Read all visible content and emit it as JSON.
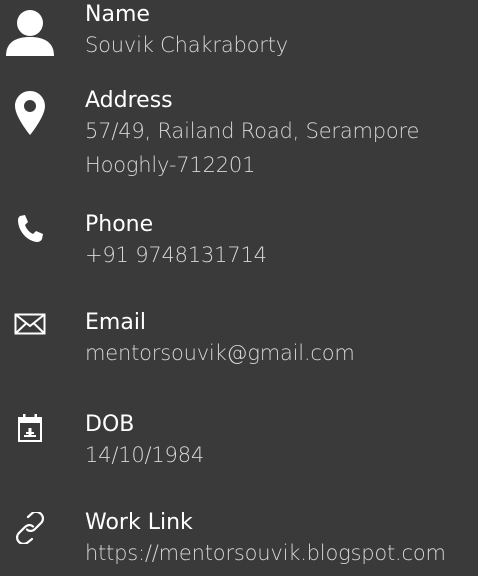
{
  "profile": {
    "name": {
      "label": "Name",
      "value": "Souvik Chakraborty",
      "icon": "user-icon"
    },
    "address": {
      "label": "Address",
      "line1": "57/49, Railand Road, Serampore",
      "line2": "Hooghly-712201",
      "icon": "location-pin-icon"
    },
    "phone": {
      "label": "Phone",
      "value": "+91 9748131714",
      "icon": "phone-icon"
    },
    "email": {
      "label": "Email",
      "value": "mentorsouvik@gmail.com",
      "icon": "envelope-icon"
    },
    "dob": {
      "label": "DOB",
      "value": "14/10/1984",
      "icon": "calendar-icon"
    },
    "work_link": {
      "label": "Work Link",
      "value": "https://mentorsouvik.blogspot.com",
      "icon": "link-icon"
    }
  },
  "colors": {
    "background": "#3a3a3a",
    "label": "#ffffff",
    "value": "#d6d6d6"
  }
}
